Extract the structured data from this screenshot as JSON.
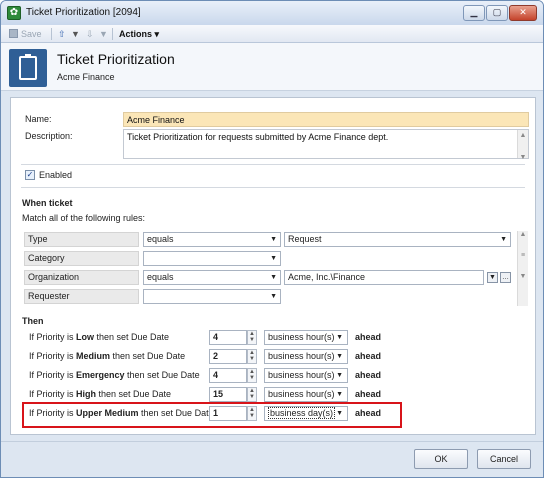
{
  "window": {
    "title": "Ticket Prioritization [2094]",
    "minimize": "▁",
    "maximize": "▢",
    "close": "✕"
  },
  "toolbar": {
    "save_label": "Save",
    "up_arrow": "⇧",
    "down_arrow": "⇩",
    "dropdown_caret": "▼",
    "actions_label": "Actions ▾"
  },
  "header": {
    "title": "Ticket Prioritization",
    "subtitle": "Acme Finance"
  },
  "form": {
    "name_label": "Name:",
    "name_value": "Acme Finance",
    "description_label": "Description:",
    "description_value": "Ticket Prioritization for requests submitted by Acme Finance dept.",
    "enabled_label": "Enabled",
    "enabled_checked": "✓"
  },
  "when": {
    "heading": "When ticket",
    "subheading": "Match all of the following rules:",
    "rules": [
      {
        "field": "Type",
        "operator": "equals",
        "value": "Request"
      },
      {
        "field": "Category",
        "operator": "",
        "value": ""
      },
      {
        "field": "Organization",
        "operator": "equals",
        "value": "Acme, Inc.\\Finance"
      },
      {
        "field": "Requester",
        "operator": "",
        "value": ""
      }
    ]
  },
  "then": {
    "heading": "Then",
    "prefix": "If Priority is ",
    "suffix": " then set Due Date",
    "ahead": "ahead",
    "rows": [
      {
        "priority": "Low",
        "amount": "4",
        "unit": "business hour(s)"
      },
      {
        "priority": "Medium",
        "amount": "2",
        "unit": "business hour(s)"
      },
      {
        "priority": "Emergency",
        "amount": "4",
        "unit": "business hour(s)"
      },
      {
        "priority": "High",
        "amount": "15",
        "unit": "business hour(s)"
      },
      {
        "priority": "Upper Medium",
        "amount": "1",
        "unit": "business day(s)"
      }
    ]
  },
  "footer": {
    "ok_label": "OK",
    "cancel_label": "Cancel"
  },
  "colors": {
    "highlight": "#d8141a",
    "name_field_bg": "#fbe6b7"
  }
}
